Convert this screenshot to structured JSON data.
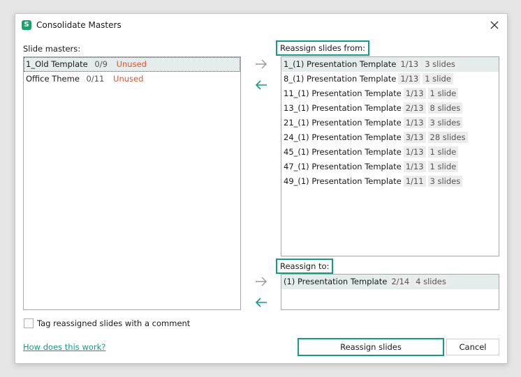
{
  "window": {
    "title": "Consolidate Masters",
    "app_icon_letter": "S"
  },
  "colors": {
    "accent": "#129c83",
    "unused": "#e0542b",
    "selection": "#e4ecec"
  },
  "masters": {
    "label": "Slide masters:",
    "items": [
      {
        "name": "1_Old Template",
        "count": "0/9",
        "status": "Unused"
      },
      {
        "name": "Office Theme",
        "count": "0/11",
        "status": "Unused"
      }
    ]
  },
  "from": {
    "label": "Reassign slides from:",
    "items": [
      {
        "name": "1_(1) Presentation Template",
        "count": "1/13",
        "slides": "3 slides"
      },
      {
        "name": "8_(1) Presentation Template",
        "count": "1/13",
        "slides": "1 slide"
      },
      {
        "name": "11_(1) Presentation Template",
        "count": "1/13",
        "slides": "1 slide"
      },
      {
        "name": "13_(1) Presentation Template",
        "count": "2/13",
        "slides": "8 slides"
      },
      {
        "name": "21_(1) Presentation Template",
        "count": "1/13",
        "slides": "3 slides"
      },
      {
        "name": "24_(1) Presentation Template",
        "count": "3/13",
        "slides": "28 slides"
      },
      {
        "name": "45_(1) Presentation Template",
        "count": "1/13",
        "slides": "1 slide"
      },
      {
        "name": "47_(1) Presentation Template",
        "count": "1/13",
        "slides": "1 slide"
      },
      {
        "name": "49_(1) Presentation Template",
        "count": "1/11",
        "slides": "3 slides"
      }
    ]
  },
  "to": {
    "label": "Reassign to:",
    "items": [
      {
        "name": "(1) Presentation Template",
        "count": "2/14",
        "slides": "4 slides"
      }
    ]
  },
  "options": {
    "tag_label": "Tag reassigned slides with a comment"
  },
  "footer": {
    "help_link": "How does this work?",
    "reassign_button": "Reassign slides",
    "cancel_button": "Cancel"
  },
  "icons": {
    "arrow_right": "arrow-right-icon",
    "arrow_left": "arrow-left-icon",
    "close": "close-icon"
  }
}
